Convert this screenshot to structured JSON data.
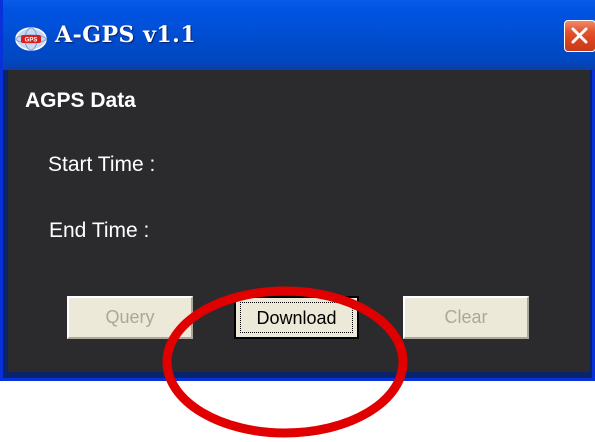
{
  "window": {
    "title": "A-GPS v1.1",
    "icon": "globe-gps-icon"
  },
  "content": {
    "heading": "AGPS Data",
    "start_time_label": "Start Time :",
    "end_time_label": "End Time :"
  },
  "buttons": {
    "query": "Query",
    "download": "Download",
    "clear": "Clear"
  },
  "colors": {
    "titlebar": "#0054e3",
    "client_background": "#2b2b2d",
    "annotation_circle": "#e00000"
  }
}
